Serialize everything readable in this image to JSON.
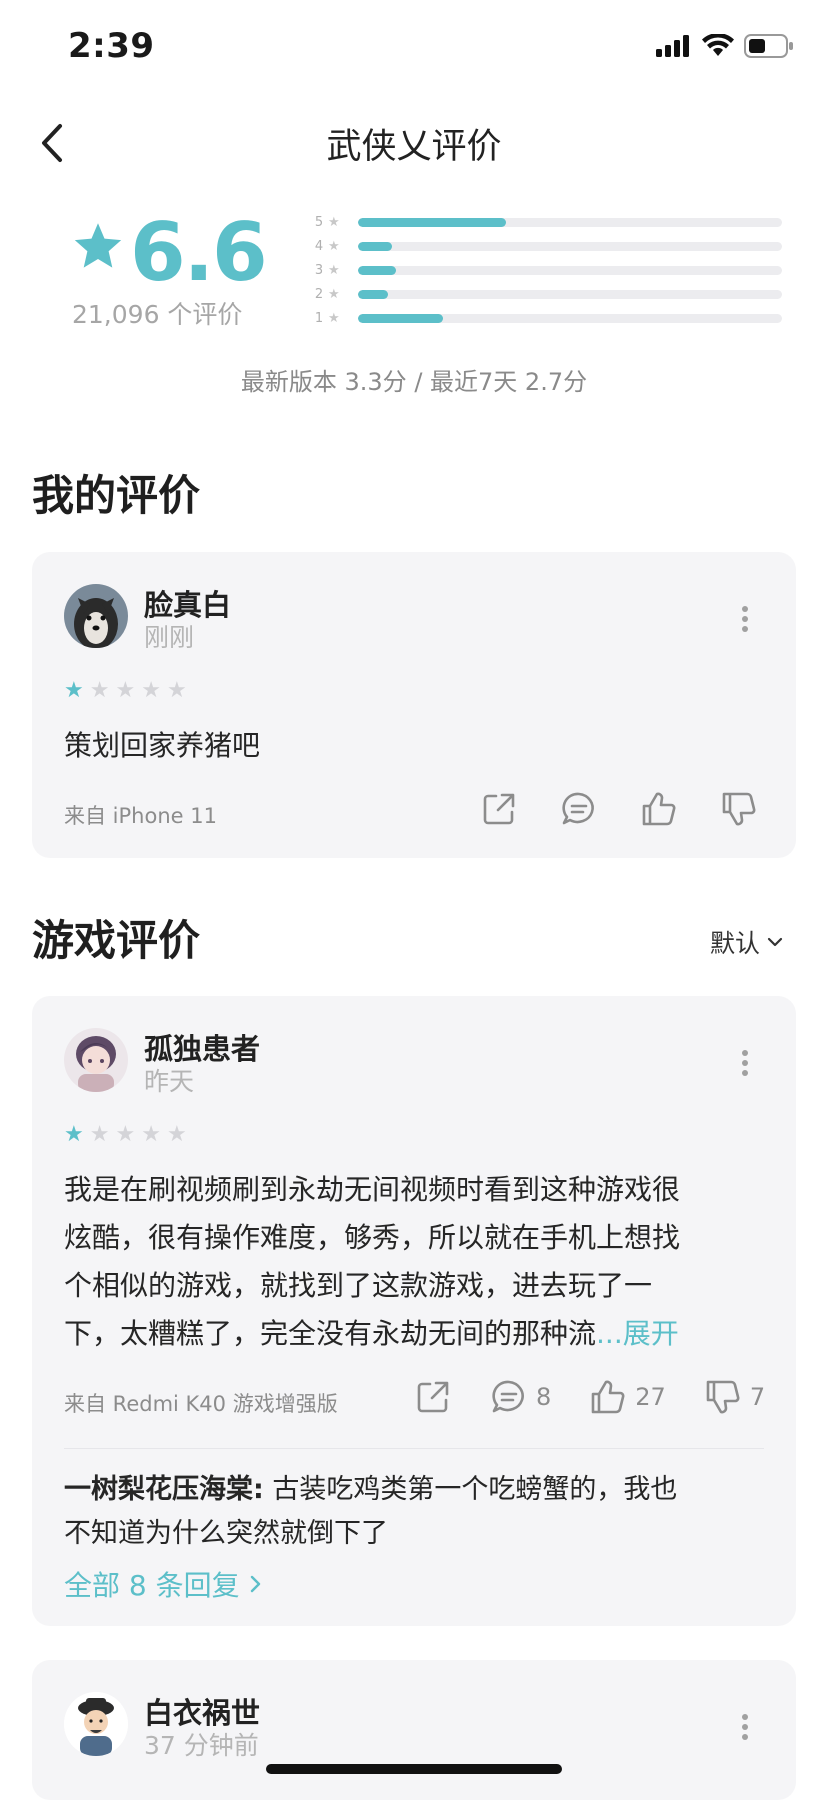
{
  "status": {
    "time": "2:39"
  },
  "nav": {
    "title": "武侠乂评价"
  },
  "rating": {
    "score": "6.6",
    "count": "21,096 个评价",
    "distribution": [
      {
        "star": "5",
        "fraction": 0.35
      },
      {
        "star": "4",
        "fraction": 0.08
      },
      {
        "star": "3",
        "fraction": 0.09
      },
      {
        "star": "2",
        "fraction": 0.07
      },
      {
        "star": "1",
        "fraction": 0.2
      }
    ],
    "version_line": "最新版本 3.3分 / 最近7天 2.7分"
  },
  "my_review": {
    "section_title": "我的评价",
    "user": "脸真白",
    "time": "刚刚",
    "stars": 1,
    "text": "策划回家养猪吧",
    "source": "来自 iPhone 11"
  },
  "game_reviews": {
    "section_title": "游戏评价",
    "sort_label": "默认",
    "items": [
      {
        "user": "孤独患者",
        "time": "昨天",
        "stars": 1,
        "lines": [
          "我是在刷视频刷到永劫无间视频时看到这种游戏很",
          "炫酷，很有操作难度，够秀，所以就在手机上想找",
          "个相似的游戏，就找到了这款游戏，进去玩了一",
          "下，太糟糕了，完全没有永劫无间的那种流"
        ],
        "expand": "...展开",
        "source": "来自 Redmi K40 游戏增强版",
        "comments": "8",
        "likes": "27",
        "dislikes": "7",
        "reply_user": "一树梨花压海棠:",
        "reply_text_1": " 古装吃鸡类第一个吃螃蟹的，我也",
        "reply_text_2": "不知道为什么突然就倒下了",
        "all_replies": "全部 8 条回复"
      },
      {
        "user": "白衣祸世",
        "time": "37 分钟前"
      }
    ]
  },
  "colors": {
    "accent": "#5cbfc9"
  }
}
